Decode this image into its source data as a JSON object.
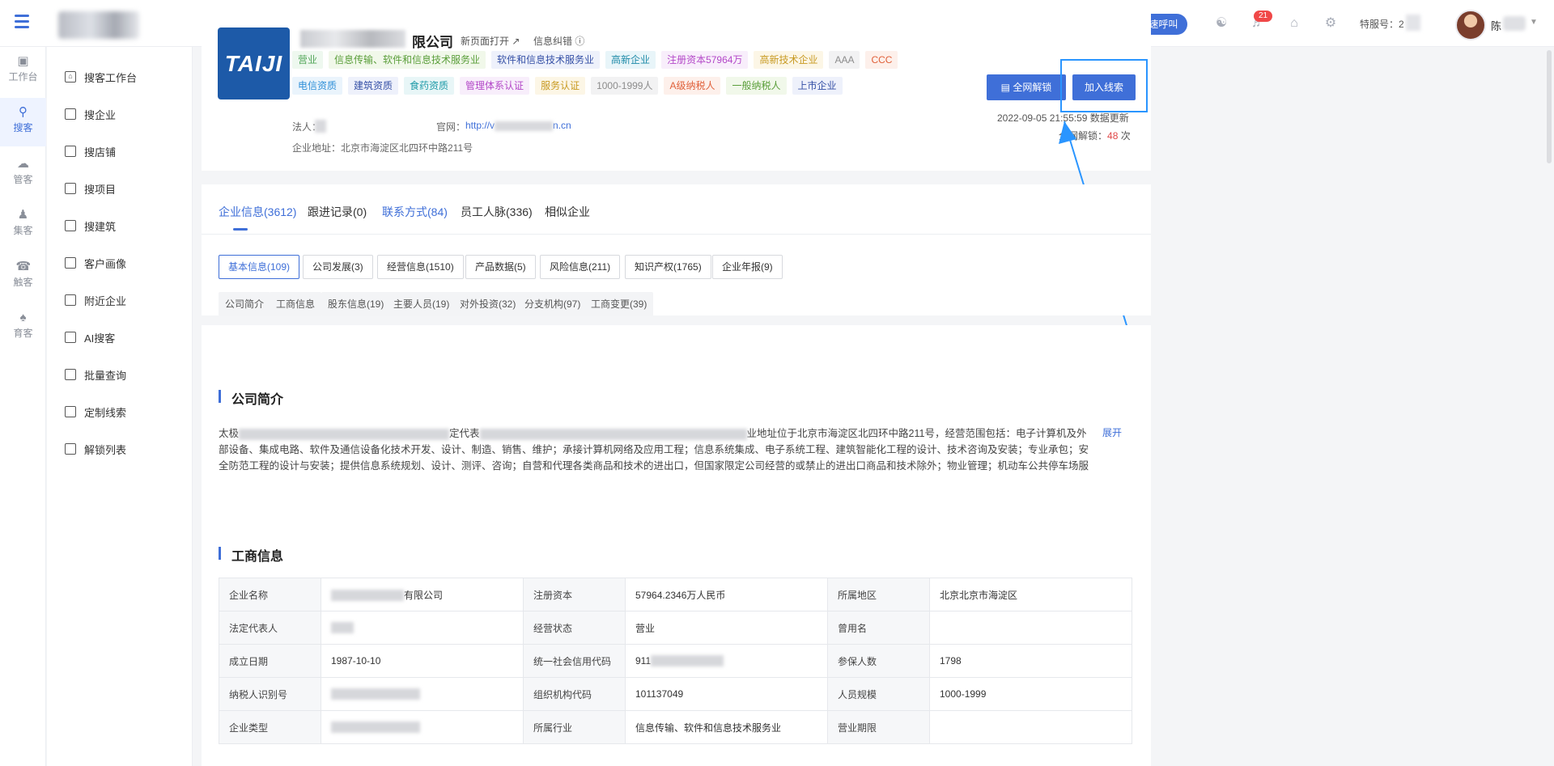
{
  "topbar": {
    "quick_call": "快速呼叫",
    "notification_count": "21",
    "service_label": "特服号：2",
    "user_name": "陈"
  },
  "rail": [
    {
      "label": "工作台",
      "icon": "workbench-icon"
    },
    {
      "label": "搜客",
      "icon": "search-customer-icon"
    },
    {
      "label": "管客",
      "icon": "cloud-icon"
    },
    {
      "label": "集客",
      "icon": "group-icon"
    },
    {
      "label": "触客",
      "icon": "headset-icon"
    },
    {
      "label": "育客",
      "icon": "nurture-icon"
    }
  ],
  "sidebar": [
    {
      "label": "搜客工作台",
      "icon": "home-icon"
    },
    {
      "label": "搜企业",
      "icon": "building-icon"
    },
    {
      "label": "搜店铺",
      "icon": "shop-icon"
    },
    {
      "label": "搜项目",
      "icon": "project-icon"
    },
    {
      "label": "搜建筑",
      "icon": "construction-icon"
    },
    {
      "label": "客户画像",
      "icon": "portrait-icon"
    },
    {
      "label": "附近企业",
      "icon": "nearby-icon"
    },
    {
      "label": "AI搜客",
      "icon": "ai-icon"
    },
    {
      "label": "批量查询",
      "icon": "batch-icon"
    },
    {
      "label": "定制线索",
      "icon": "custom-lead-icon"
    },
    {
      "label": "解锁列表",
      "icon": "unlock-list-icon"
    }
  ],
  "company": {
    "logo_text": "TAIJI",
    "name_prefix": "",
    "name_suffix": "限公司",
    "open_new": "新页面打开",
    "correct": "信息纠错",
    "tags_row1": [
      {
        "text": "营业",
        "color": "#52a65a",
        "bg": "#eef8ef"
      },
      {
        "text": "信息传输、软件和信息技术服务业",
        "color": "#5a9e3a",
        "bg": "#f1f8ea"
      },
      {
        "text": "软件和信息技术服务业",
        "color": "#3550a6",
        "bg": "#eef1fb"
      },
      {
        "text": "高新企业",
        "color": "#1e8aa8",
        "bg": "#e8f5f9"
      },
      {
        "text": "注册资本57964万",
        "color": "#b348c8",
        "bg": "#f8eefb"
      },
      {
        "text": "高新技术企业",
        "color": "#c89a22",
        "bg": "#fcf6e6"
      },
      {
        "text": "AAA",
        "color": "#8c8c8c",
        "bg": "#f2f2f3"
      },
      {
        "text": "CCC",
        "color": "#e0603a",
        "bg": "#fdf0eb"
      }
    ],
    "tags_row2": [
      {
        "text": "电信资质",
        "color": "#2f8fd8",
        "bg": "#eaf4fc"
      },
      {
        "text": "建筑资质",
        "color": "#3550a6",
        "bg": "#eef1fb"
      },
      {
        "text": "食药资质",
        "color": "#1e9aa8",
        "bg": "#e8f6f7"
      },
      {
        "text": "管理体系认证",
        "color": "#b348c8",
        "bg": "#f8eefb"
      },
      {
        "text": "服务认证",
        "color": "#c89a22",
        "bg": "#fcf6e6"
      },
      {
        "text": "1000-1999人",
        "color": "#8c8c8c",
        "bg": "#f2f2f3"
      },
      {
        "text": "A级纳税人",
        "color": "#e0603a",
        "bg": "#fdf0eb"
      },
      {
        "text": "一般纳税人",
        "color": "#5a9e3a",
        "bg": "#f1f8ea"
      },
      {
        "text": "上市企业",
        "color": "#3550a6",
        "bg": "#eef1fb"
      }
    ],
    "legal_label": "法人：",
    "website_label": "官网：",
    "website_prefix": "http://v",
    "website_suffix": "n.cn",
    "address": "企业地址：北京市海淀区北四环中路211号",
    "btn_unlock": "全网解锁",
    "btn_lead": "加入线索",
    "date": "2022-09-05 21:55:59",
    "data_update": "数据更新",
    "unlock_prefix": "全网解锁：",
    "unlock_count": "8",
    "unlock_suffix": "次"
  },
  "tabs": [
    {
      "label": "企业信息(3612)",
      "state": "active"
    },
    {
      "label": "跟进记录(0)",
      "state": "normal"
    },
    {
      "label": "联系方式(84)",
      "state": "blue"
    },
    {
      "label": "员工人脉(336)",
      "state": "normal"
    },
    {
      "label": "相似企业",
      "state": "normal"
    }
  ],
  "pills": [
    "基本信息(109)",
    "公司发展(3)",
    "经营信息(1510)",
    "产品数据(5)",
    "风险信息(211)",
    "知识产权(1765)",
    "企业年报(9)"
  ],
  "chips": [
    "公司简介",
    "工商信息",
    "股东信息(19)",
    "主要人员(19)",
    "对外投资(32)",
    "分支机构(97)",
    "工商变更(39)"
  ],
  "intro": {
    "title": "公司简介",
    "line1_a": "太极",
    "line1_b": "定代表",
    "line1_c": "业地址位于北京市海淀区北四环中路211号，经营范围包括：电子计算机及外",
    "line2": "部设备、集成电路、软件及通信设备化技术开发、设计、制造、销售、维护；承接计算机网络及应用工程；信息系统集成、电子系统工程、建筑智能化工程的设计、技术咨询及安装；专业承包；安",
    "line3": "全防范工程的设计与安装；提供信息系统规划、设计、测评、咨询；自营和代理各类商品和技术的进出口，但国家限定公司经营的或禁止的进出口商品和技术除外；物业管理；机动车公共停车场服",
    "expand": "展开"
  },
  "business": {
    "title": "工商信息",
    "rows": [
      [
        "企业名称",
        "有限公司",
        "注册资本",
        "57964.2346万人民币",
        "所属地区",
        "北京北京市海淀区"
      ],
      [
        "法定代表人",
        "",
        "经营状态",
        "营业",
        "曾用名",
        ""
      ],
      [
        "成立日期",
        "1987-10-10",
        "统一社会信用代码",
        "911",
        "参保人数",
        "1798"
      ],
      [
        "纳税人识别号",
        "",
        "组织机构代码",
        "101137049",
        "人员规模",
        "1000-1999"
      ],
      [
        "企业类型",
        "",
        "所属行业",
        "信息传输、软件和信息技术服务业",
        "营业期限",
        ""
      ]
    ]
  }
}
